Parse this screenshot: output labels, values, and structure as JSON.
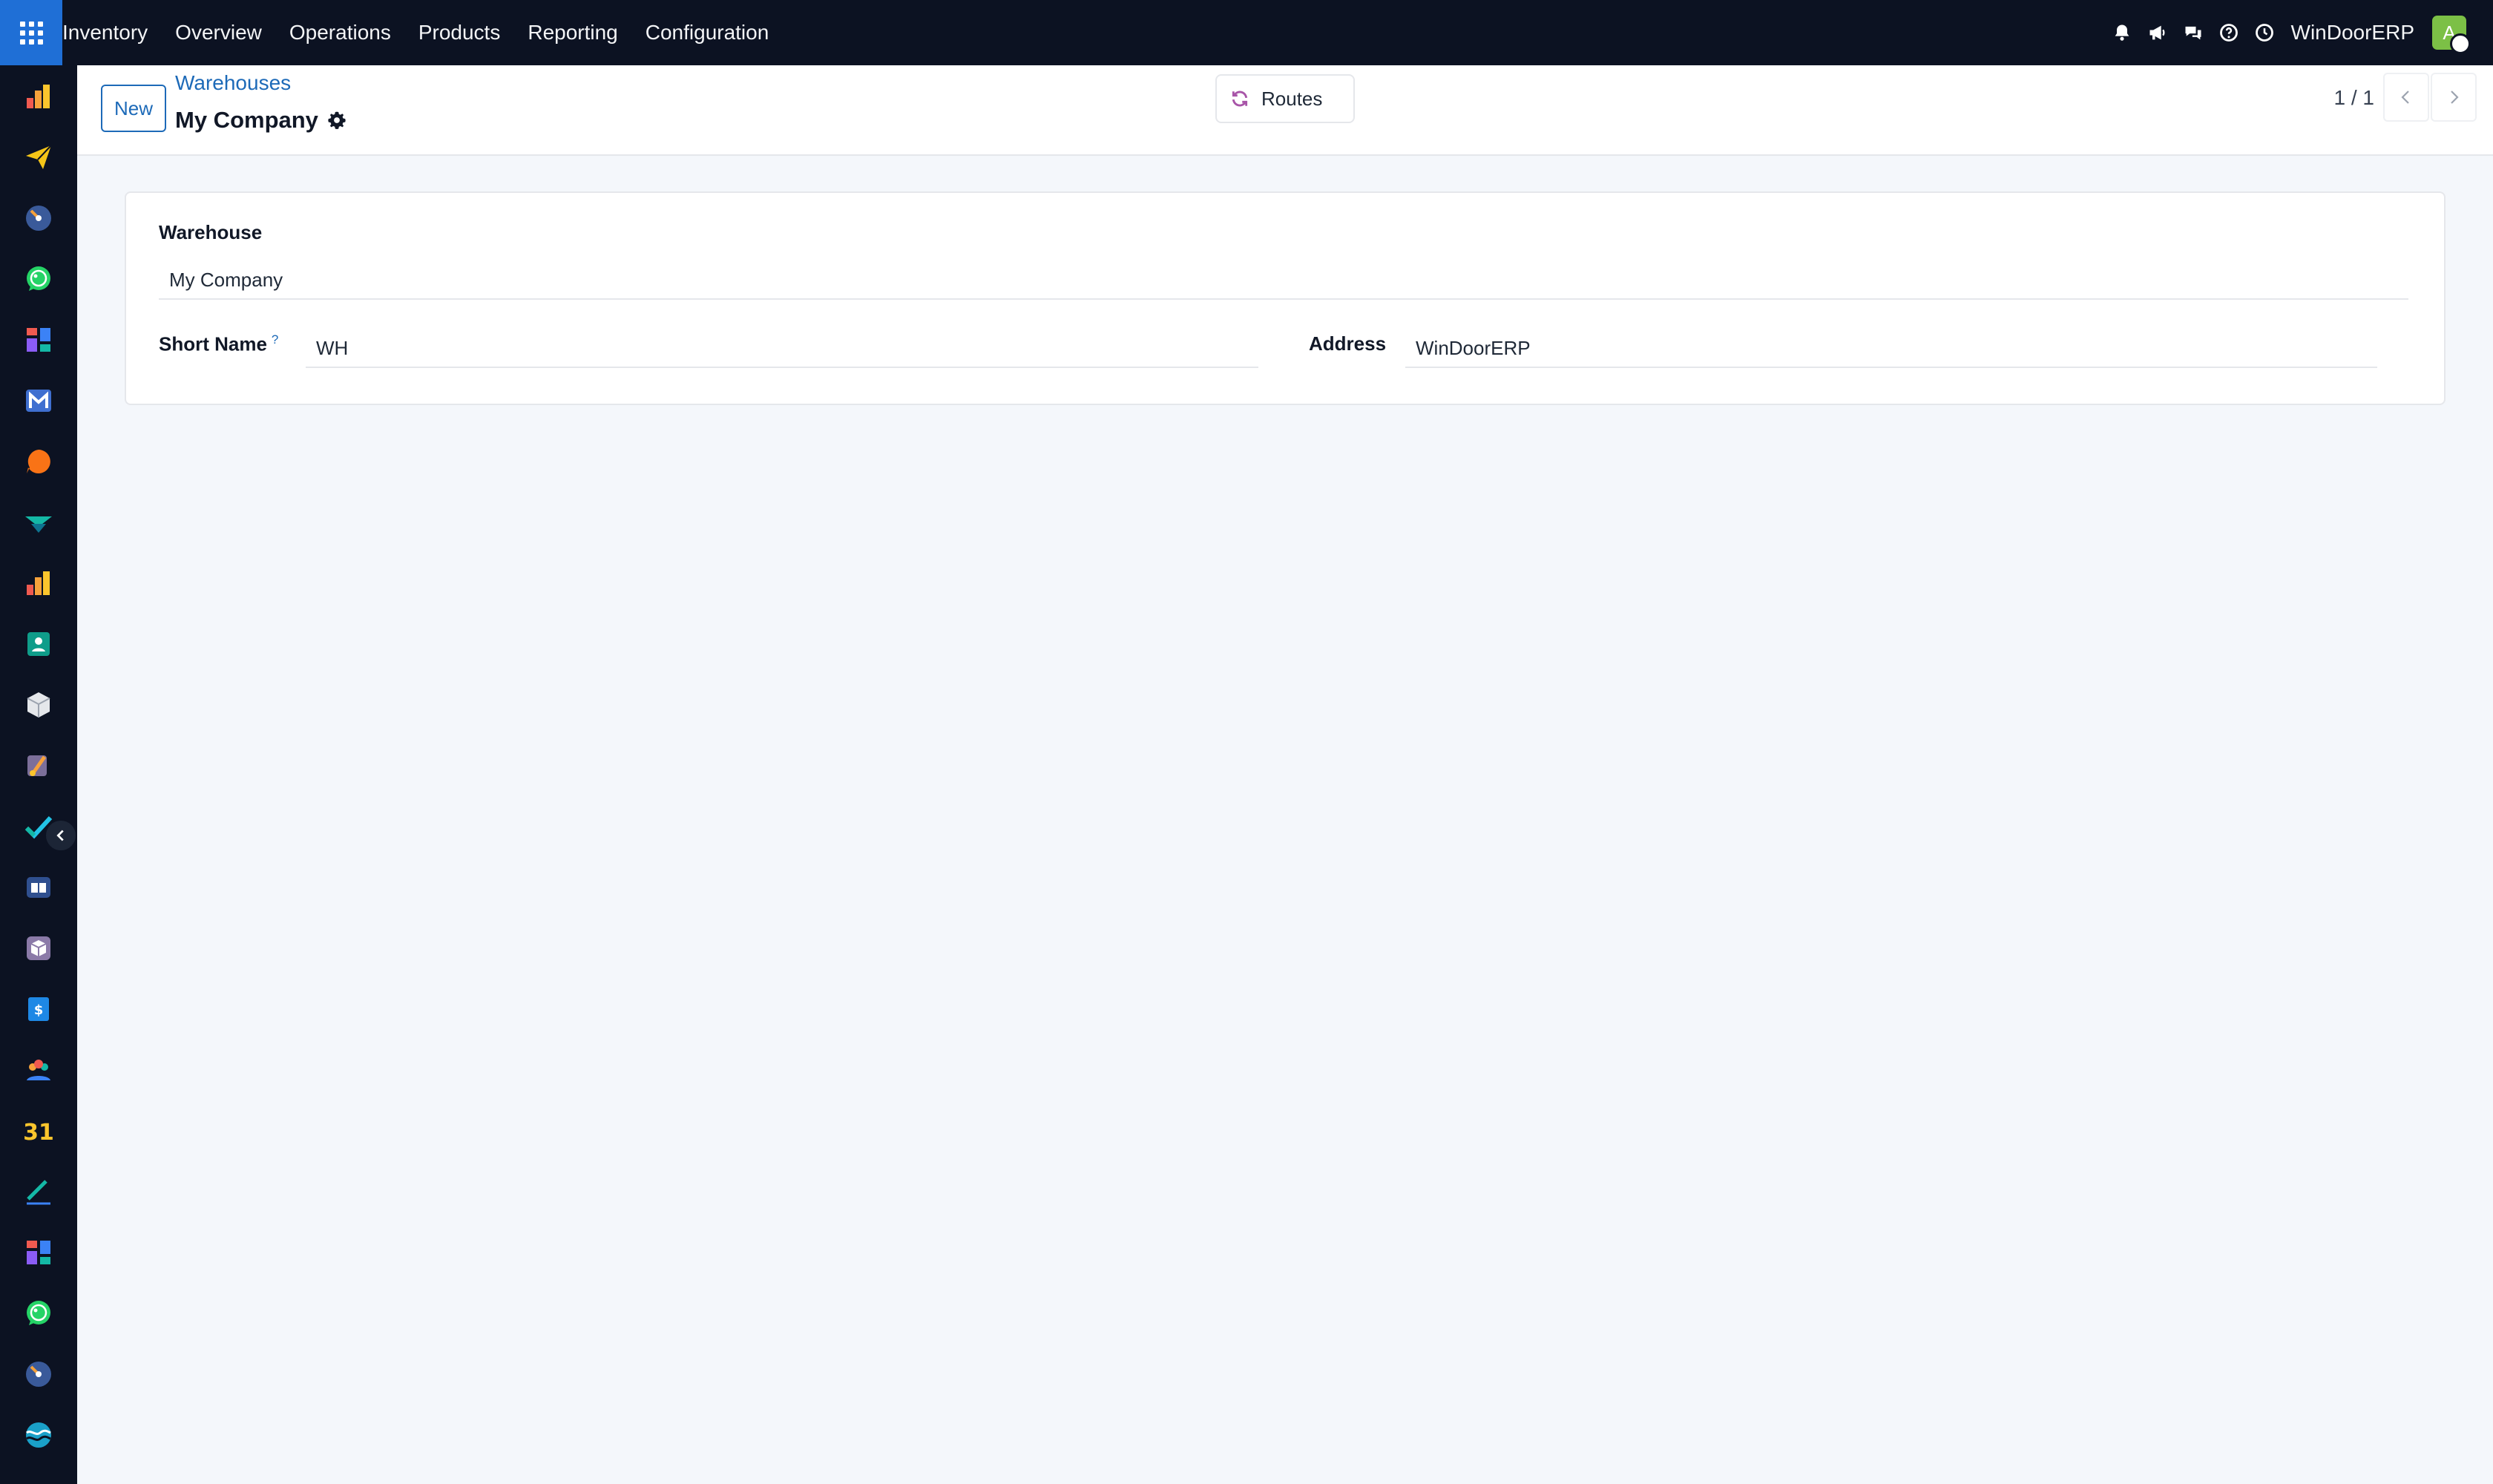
{
  "navbar": {
    "menu": [
      "Inventory",
      "Overview",
      "Operations",
      "Products",
      "Reporting",
      "Configuration"
    ],
    "company_name": "WinDoorERP",
    "avatar_letter": "A",
    "icons": [
      "bell-icon",
      "megaphone-icon",
      "chat-icon",
      "help-icon",
      "clock-icon"
    ]
  },
  "sidebar": {
    "apps": [
      "dashboard-bars-icon",
      "paper-plane-icon",
      "speedometer-icon",
      "whatsapp-icon",
      "grid-blocks-icon",
      "gmail-icon",
      "chat-bubble-icon",
      "stacked-chevrons-icon",
      "dashboard-bars-icon",
      "contact-card-icon",
      "box-icon",
      "brush-icon",
      "checkmark-icon",
      "book-icon",
      "package-icon",
      "invoice-icon",
      "team-icon",
      "calendar-icon",
      "pen-icon",
      "grid-blocks-icon",
      "whatsapp-icon",
      "speedometer-icon",
      "waves-icon"
    ]
  },
  "control_panel": {
    "new_label": "New",
    "breadcrumb": "Warehouses",
    "record_title": "My Company",
    "routes_label": "Routes",
    "pager": "1 / 1"
  },
  "form": {
    "warehouse_label": "Warehouse",
    "warehouse_value": "My Company",
    "short_name_label": "Short Name",
    "short_name_help": "?",
    "short_name_value": "WH",
    "address_label": "Address",
    "address_value": "WinDoorERP"
  },
  "colors": {
    "navbar_bg": "#0c1222",
    "apps_button": "#1f6fd6",
    "link": "#1d6ab8",
    "avatar": "#7cc046",
    "page_bg": "#f4f7fb"
  }
}
